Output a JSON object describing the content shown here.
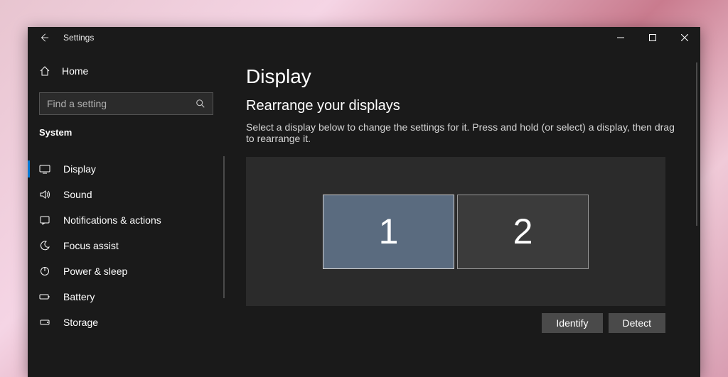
{
  "window": {
    "title": "Settings"
  },
  "sidebar": {
    "home_label": "Home",
    "search_placeholder": "Find a setting",
    "category_label": "System",
    "items": [
      {
        "icon": "display",
        "label": "Display",
        "active": true
      },
      {
        "icon": "sound",
        "label": "Sound",
        "active": false
      },
      {
        "icon": "notifications",
        "label": "Notifications & actions",
        "active": false
      },
      {
        "icon": "focus-assist",
        "label": "Focus assist",
        "active": false
      },
      {
        "icon": "power",
        "label": "Power & sleep",
        "active": false
      },
      {
        "icon": "battery",
        "label": "Battery",
        "active": false
      },
      {
        "icon": "storage",
        "label": "Storage",
        "active": false
      }
    ]
  },
  "main": {
    "page_title": "Display",
    "section_title": "Rearrange your displays",
    "description": "Select a display below to change the settings for it. Press and hold (or select) a display, then drag to rearrange it.",
    "monitors": [
      {
        "number": "1",
        "selected": true
      },
      {
        "number": "2",
        "selected": false
      }
    ],
    "identify_label": "Identify",
    "detect_label": "Detect"
  }
}
